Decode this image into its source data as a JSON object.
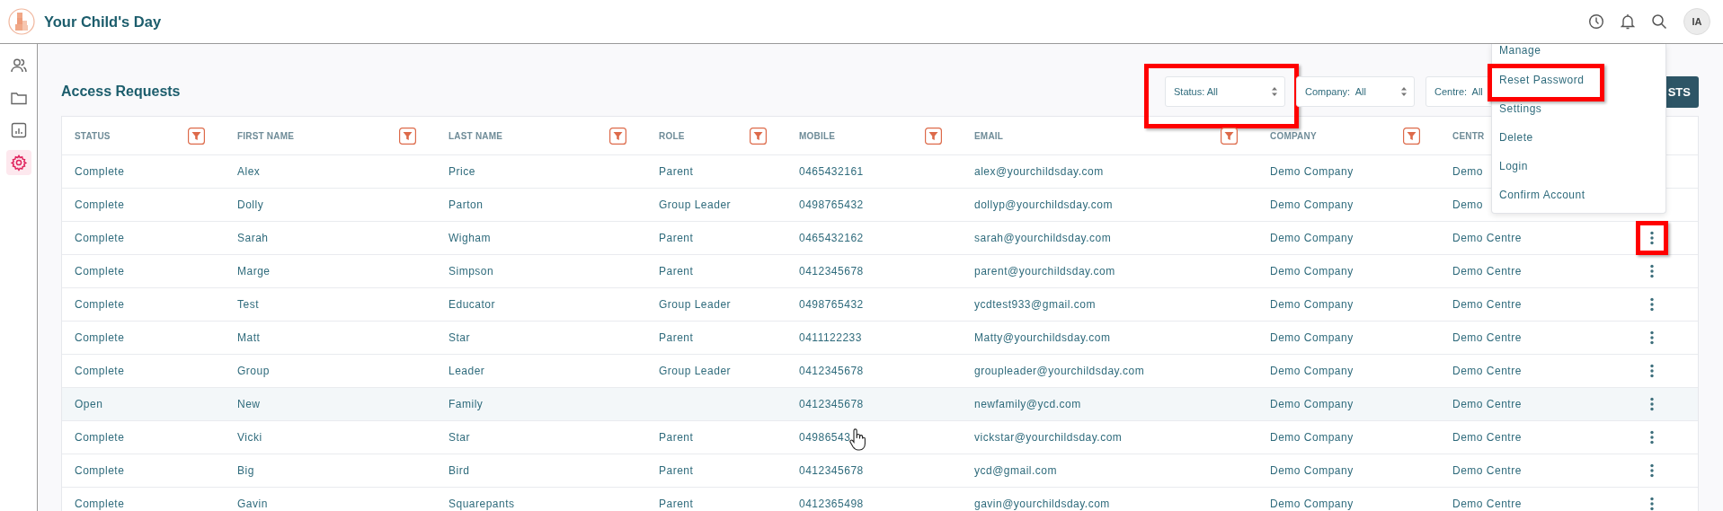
{
  "app_title": "Your Child's Day",
  "header": {
    "avatar": "IA"
  },
  "sidebar": {
    "items": [
      {
        "kind": "people",
        "selected": false
      },
      {
        "kind": "folder",
        "selected": false
      },
      {
        "kind": "report",
        "selected": false
      },
      {
        "kind": "settings",
        "selected": true
      }
    ]
  },
  "page_title": "Access Requests",
  "filters": [
    {
      "label": "Status: All",
      "highlighted": true,
      "arrows": true
    },
    {
      "label": "Company:  All",
      "highlighted": false,
      "arrows": true
    },
    {
      "label": "Centre:  All",
      "highlighted": false,
      "arrows": false
    }
  ],
  "action_button": "STS",
  "table": {
    "columns": [
      {
        "label": "STATUS",
        "filter": true
      },
      {
        "label": "FIRST NAME",
        "filter": true
      },
      {
        "label": "LAST NAME",
        "filter": true
      },
      {
        "label": "ROLE",
        "filter": true
      },
      {
        "label": "MOBILE",
        "filter": true
      },
      {
        "label": "EMAIL",
        "filter": true
      },
      {
        "label": "COMPANY",
        "filter": true
      },
      {
        "label": "CENTR",
        "filter": false
      }
    ],
    "rows": [
      {
        "cells": [
          "Complete",
          "Alex",
          "Price",
          "Parent",
          "0465432161",
          "alex@yourchildsday.com",
          "Demo Company",
          "Demo"
        ],
        "actions": false,
        "highlighted": false,
        "hovered": false,
        "cursor": false
      },
      {
        "cells": [
          "Complete",
          "Dolly",
          "Parton",
          "Group Leader",
          "0498765432",
          "dollyp@yourchildsday.com",
          "Demo Company",
          "Demo"
        ],
        "actions": false,
        "highlighted": false,
        "hovered": false,
        "cursor": false
      },
      {
        "cells": [
          "Complete",
          "Sarah",
          "Wigham",
          "Parent",
          "0465432162",
          "sarah@yourchildsday.com",
          "Demo Company",
          "Demo Centre"
        ],
        "actions": true,
        "highlighted": true,
        "hovered": false,
        "cursor": false
      },
      {
        "cells": [
          "Complete",
          "Marge",
          "Simpson",
          "Parent",
          "0412345678",
          "parent@yourchildsday.com",
          "Demo Company",
          "Demo Centre"
        ],
        "actions": true,
        "highlighted": false,
        "hovered": false,
        "cursor": false
      },
      {
        "cells": [
          "Complete",
          "Test",
          "Educator",
          "Group Leader",
          "0498765432",
          "ycdtest933@gmail.com",
          "Demo Company",
          "Demo Centre"
        ],
        "actions": true,
        "highlighted": false,
        "hovered": false,
        "cursor": false
      },
      {
        "cells": [
          "Complete",
          "Matt",
          "Star",
          "Parent",
          "0411122233",
          "Matty@yourchildsday.com",
          "Demo Company",
          "Demo Centre"
        ],
        "actions": true,
        "highlighted": false,
        "hovered": false,
        "cursor": false
      },
      {
        "cells": [
          "Complete",
          "Group",
          "Leader",
          "Group Leader",
          "0412345678",
          "groupleader@yourchildsday.com",
          "Demo Company",
          "Demo Centre"
        ],
        "actions": true,
        "highlighted": false,
        "hovered": false,
        "cursor": false
      },
      {
        "cells": [
          "Open",
          "New",
          "Family",
          "",
          "0412345678",
          "newfamily@ycd.com",
          "Demo Company",
          "Demo Centre"
        ],
        "actions": true,
        "highlighted": false,
        "hovered": true,
        "cursor": false
      },
      {
        "cells": [
          "Complete",
          "Vicki",
          "Star",
          "Parent",
          "04986543",
          "vickstar@yourchildsday.com",
          "Demo Company",
          "Demo Centre"
        ],
        "actions": true,
        "highlighted": false,
        "hovered": false,
        "cursor": true
      },
      {
        "cells": [
          "Complete",
          "Big",
          "Bird",
          "Parent",
          "0412345678",
          "ycd@gmail.com",
          "Demo Company",
          "Demo Centre"
        ],
        "actions": true,
        "highlighted": false,
        "hovered": false,
        "cursor": false
      },
      {
        "cells": [
          "Complete",
          "Gavin",
          "Squarepants",
          "Parent",
          "0412365498",
          "gavin@yourchildsday.com",
          "Demo Company",
          "Demo Centre"
        ],
        "actions": true,
        "highlighted": false,
        "hovered": false,
        "cursor": false
      }
    ]
  },
  "menu": {
    "items": [
      {
        "label": "Manage",
        "highlighted": false
      },
      {
        "label": "Reset Password",
        "highlighted": true
      },
      {
        "label": "Settings",
        "highlighted": false
      },
      {
        "label": "Delete",
        "highlighted": false
      },
      {
        "label": "Login",
        "highlighted": false
      },
      {
        "label": "Confirm Account",
        "highlighted": false
      }
    ]
  }
}
